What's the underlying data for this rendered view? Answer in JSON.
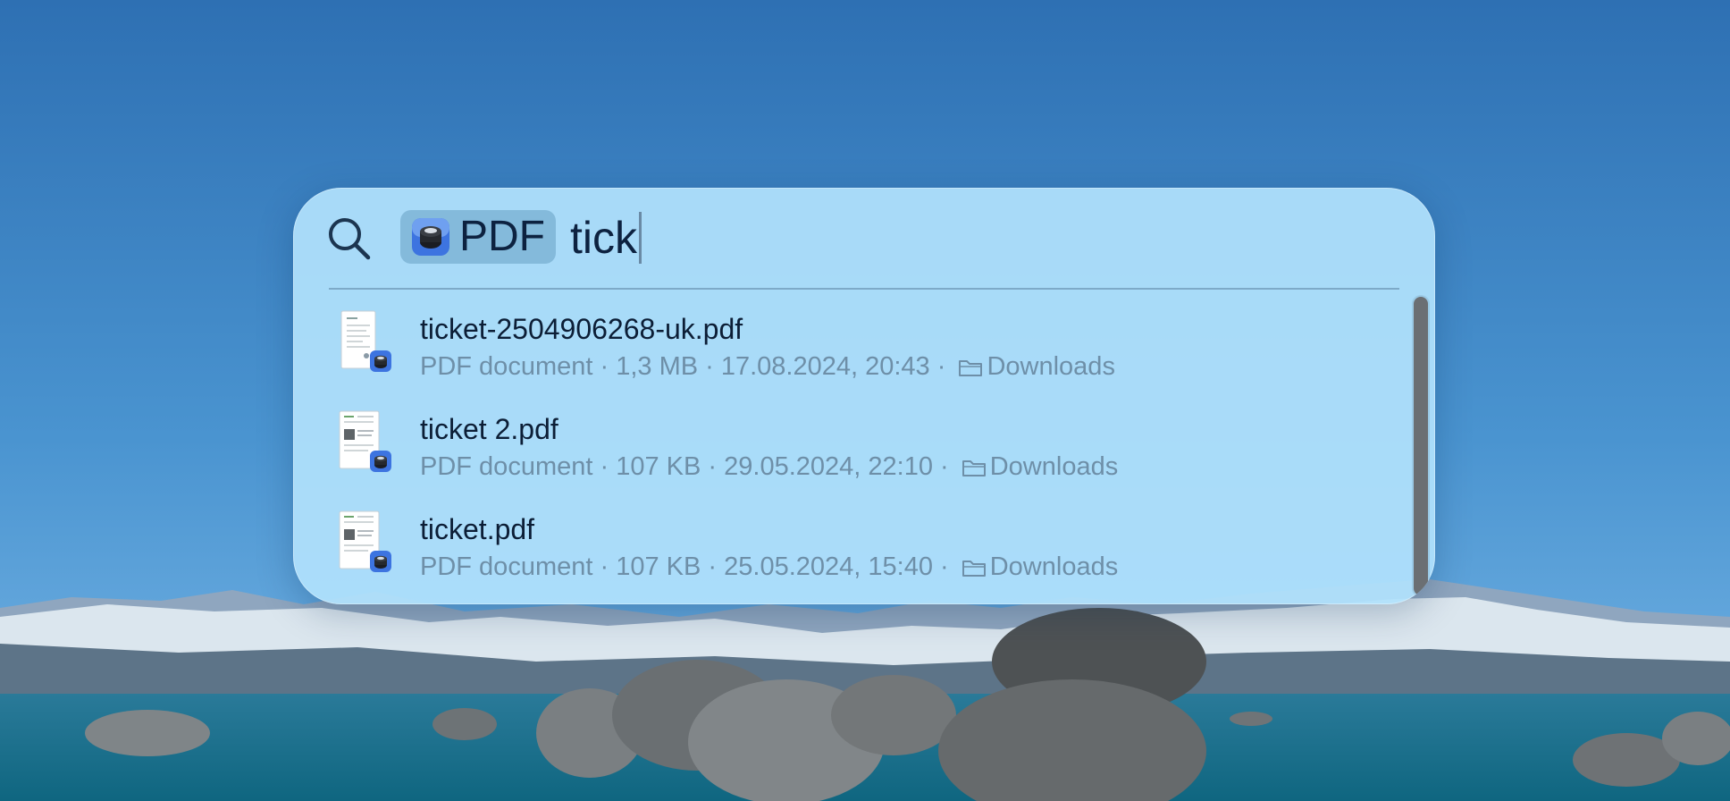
{
  "spotlight": {
    "search_icon": "magnifying-glass-icon",
    "filter_token": {
      "app_icon": "pdf-app-icon",
      "label": "PDF"
    },
    "query": "tick",
    "results": [
      {
        "name": "ticket-2504906268-uk.pdf",
        "kind": "PDF document",
        "size": "1,3 MB",
        "date": "17.08.2024, 20:43",
        "folder": "Downloads"
      },
      {
        "name": "ticket 2.pdf",
        "kind": "PDF document",
        "size": "107 KB",
        "date": "29.05.2024, 22:10",
        "folder": "Downloads"
      },
      {
        "name": "ticket.pdf",
        "kind": "PDF document",
        "size": "107 KB",
        "date": "25.05.2024, 15:40",
        "folder": "Downloads"
      }
    ],
    "separator": " · "
  },
  "colors": {
    "panel": "#b0e1fc",
    "token_bg": "#78afd2",
    "text_primary": "#0c1e36",
    "text_secondary": "#6e8fa8",
    "scroll_thumb": "#6b6f73"
  }
}
